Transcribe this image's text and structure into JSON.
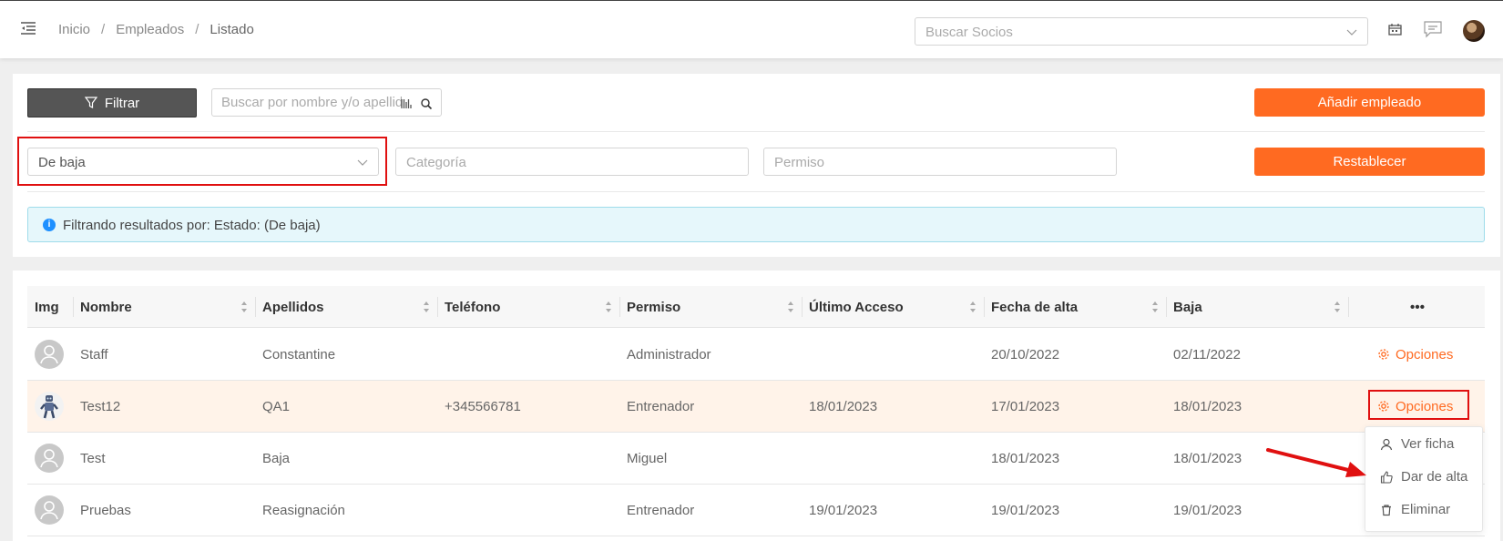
{
  "header": {
    "breadcrumb": [
      "Inicio",
      "Empleados",
      "Listado"
    ],
    "socios_placeholder": "Buscar Socios"
  },
  "toolbar": {
    "filter_label": "Filtrar",
    "search_placeholder": "Buscar por nombre y/o apellidos",
    "add_label": "Añadir empleado",
    "reset_label": "Restablecer",
    "estado_value": "De baja",
    "categoria_placeholder": "Categoría",
    "permiso_placeholder": "Permiso",
    "info_text": "Filtrando resultados por: Estado: (De baja)"
  },
  "table": {
    "headers": [
      "Img",
      "Nombre",
      "Apellidos",
      "Teléfono",
      "Permiso",
      "Último Acceso",
      "Fecha de alta",
      "Baja"
    ],
    "more_label": "• • •",
    "options_label": "Opciones",
    "rows": [
      {
        "nombre": "Staff",
        "apellidos": "Constantine",
        "telefono": "",
        "permiso": "Administrador",
        "ultimo": "",
        "alta": "20/10/2022",
        "baja": "02/11/2022"
      },
      {
        "nombre": "Test12",
        "apellidos": "QA1",
        "telefono": "+345566781",
        "permiso": "Entrenador",
        "ultimo": "18/01/2023",
        "alta": "17/01/2023",
        "baja": "18/01/2023"
      },
      {
        "nombre": "Test",
        "apellidos": "Baja",
        "telefono": "",
        "permiso": "Miguel",
        "ultimo": "",
        "alta": "18/01/2023",
        "baja": "18/01/2023"
      },
      {
        "nombre": "Pruebas",
        "apellidos": "Reasignación",
        "telefono": "",
        "permiso": "Entrenador",
        "ultimo": "19/01/2023",
        "alta": "19/01/2023",
        "baja": "19/01/2023"
      }
    ]
  },
  "dropdown": {
    "ver_ficha": "Ver ficha",
    "dar_alta": "Dar de alta",
    "eliminar": "Eliminar"
  },
  "colors": {
    "accent": "#ff6a21",
    "highlight_row": "#fff3e9",
    "annotation": "#e01010"
  }
}
